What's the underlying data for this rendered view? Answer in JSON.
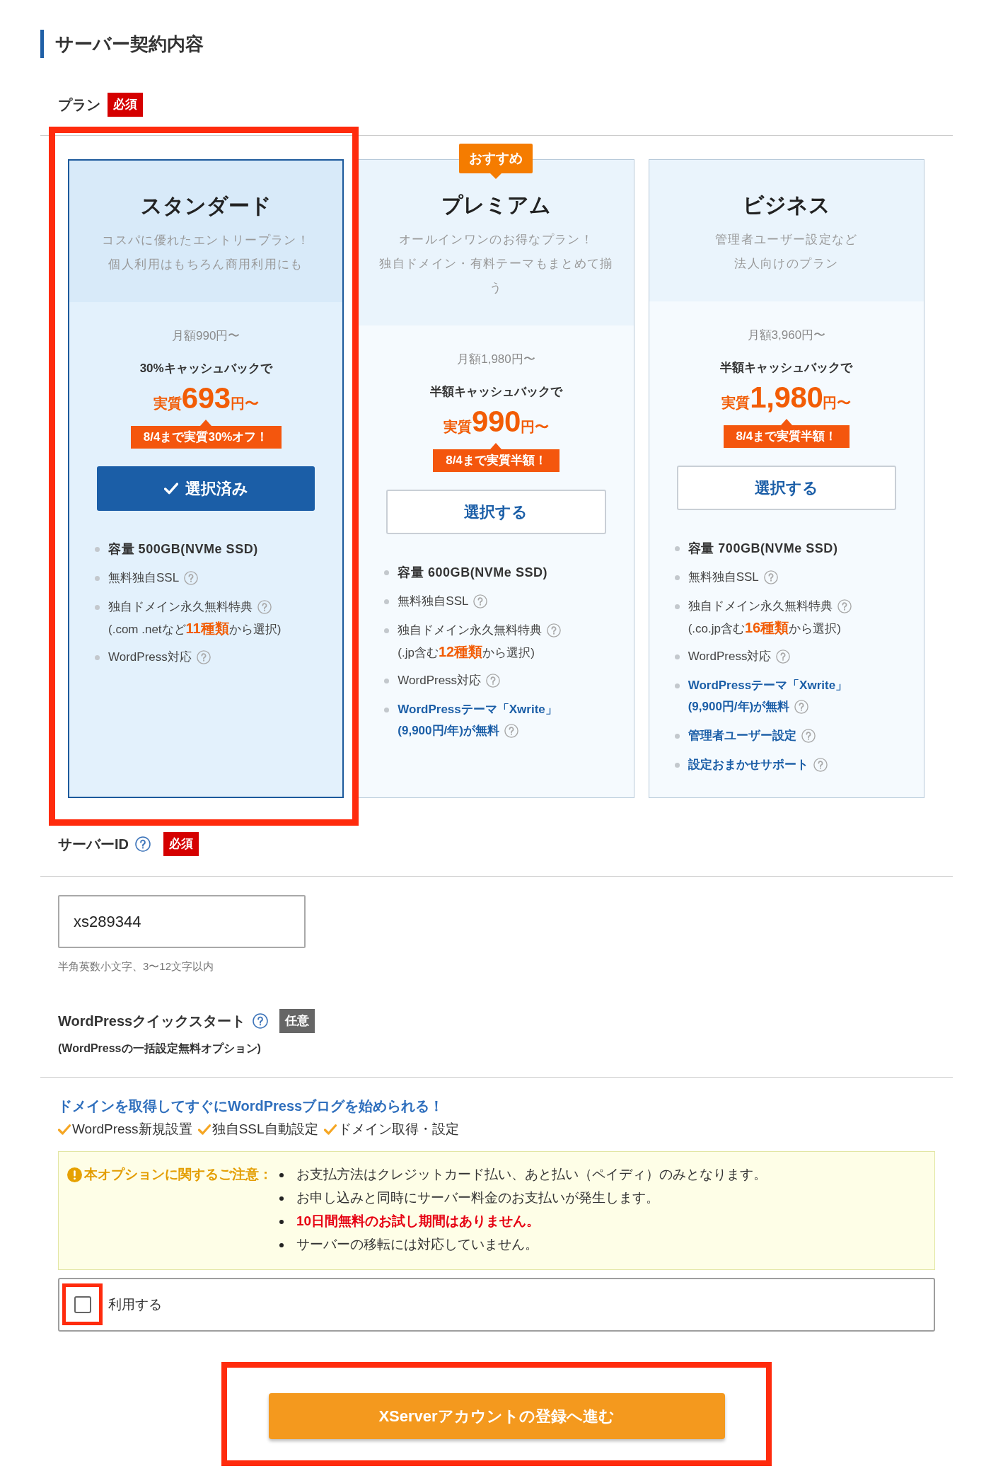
{
  "section": {
    "title": "サーバー契約内容"
  },
  "plan_field": {
    "label": "プラン",
    "badge": {
      "text": "必須",
      "kind": "required"
    }
  },
  "plans": [
    {
      "name": "スタンダード",
      "description": [
        "コスパに優れたエントリープラン！",
        "個人利用はもちろん商用利用にも"
      ],
      "monthly": "月額990円〜",
      "cashback": "30%キャッシュバックで",
      "price": {
        "prefix": "実質",
        "amount": "693",
        "suffix": "円〜"
      },
      "tag": "8/4まで実質30%オフ！",
      "button_label": "選択済み",
      "selected": true,
      "highlighted": true,
      "features": [
        {
          "kind": "capacity",
          "lines": [
            {
              "text": "容量 500GB(NVMe SSD)",
              "help": false
            }
          ]
        },
        {
          "kind": "plain",
          "lines": [
            {
              "text": "無料独自SSL",
              "help": true
            }
          ]
        },
        {
          "kind": "plain",
          "lines": [
            {
              "text": "独自ドメイン永久無料特典",
              "help": true
            },
            {
              "text": "(.com .netなど**11種類**から選択)",
              "help": false
            }
          ]
        },
        {
          "kind": "plain",
          "lines": [
            {
              "text": "WordPress対応",
              "help": true
            }
          ]
        }
      ]
    },
    {
      "name": "プレミアム",
      "badge": "おすすめ",
      "description": [
        "オールインワンのお得なプラン！",
        "独自ドメイン・有料テーマもまとめて揃う"
      ],
      "monthly": "月額1,980円〜",
      "cashback": "半額キャッシュバックで",
      "price": {
        "prefix": "実質",
        "amount": "990",
        "suffix": "円〜"
      },
      "tag": "8/4まで実質半額！",
      "button_label": "選択する",
      "selected": false,
      "highlighted": false,
      "features": [
        {
          "kind": "capacity",
          "lines": [
            {
              "text": "容量 600GB(NVMe SSD)",
              "help": false
            }
          ]
        },
        {
          "kind": "plain",
          "lines": [
            {
              "text": "無料独自SSL",
              "help": true
            }
          ]
        },
        {
          "kind": "plain",
          "lines": [
            {
              "text": "独自ドメイン永久無料特典",
              "help": true
            },
            {
              "text": "(.jp含む**12種類**から選択)",
              "help": false
            }
          ]
        },
        {
          "kind": "plain",
          "lines": [
            {
              "text": "WordPress対応",
              "help": true
            }
          ]
        },
        {
          "kind": "highlight",
          "lines": [
            {
              "text": "WordPressテーマ「Xwrite」",
              "help": false
            },
            {
              "text": "(9,900円/年)が無料",
              "help": true
            }
          ]
        }
      ]
    },
    {
      "name": "ビジネス",
      "description": [
        "管理者ユーザー設定など",
        "法人向けのプラン"
      ],
      "monthly": "月額3,960円〜",
      "cashback": "半額キャッシュバックで",
      "price": {
        "prefix": "実質",
        "amount": "1,980",
        "suffix": "円〜"
      },
      "tag": "8/4まで実質半額！",
      "button_label": "選択する",
      "selected": false,
      "highlighted": false,
      "features": [
        {
          "kind": "capacity",
          "lines": [
            {
              "text": "容量 700GB(NVMe SSD)",
              "help": false
            }
          ]
        },
        {
          "kind": "plain",
          "lines": [
            {
              "text": "無料独自SSL",
              "help": true
            }
          ]
        },
        {
          "kind": "plain",
          "lines": [
            {
              "text": "独自ドメイン永久無料特典",
              "help": true
            },
            {
              "text": "(.co.jp含む**16種類**から選択)",
              "help": false
            }
          ]
        },
        {
          "kind": "plain",
          "lines": [
            {
              "text": "WordPress対応",
              "help": true
            }
          ]
        },
        {
          "kind": "highlight",
          "lines": [
            {
              "text": "WordPressテーマ「Xwrite」",
              "help": false
            },
            {
              "text": "(9,900円/年)が無料",
              "help": true
            }
          ]
        },
        {
          "kind": "highlight",
          "lines": [
            {
              "text": "管理者ユーザー設定",
              "help": true
            }
          ]
        },
        {
          "kind": "highlight",
          "lines": [
            {
              "text": "設定おまかせサポート",
              "help": true
            }
          ]
        }
      ]
    }
  ],
  "server_id": {
    "label": "サーバーID",
    "help": true,
    "badge": {
      "text": "必須",
      "kind": "required"
    },
    "value": "xs289344",
    "hint": "半角英数小文字、3〜12文字以内"
  },
  "quick_start": {
    "label": "WordPressクイックスタート",
    "help": true,
    "badge": {
      "text": "任意",
      "kind": "optional"
    },
    "sublabel": "(WordPressの一括設定無料オプション)",
    "headline": "ドメインを取得してすぐにWordPressブログを始められる！",
    "features": [
      "WordPress新規設置",
      "独自SSL自動設定",
      "ドメイン取得・設定"
    ],
    "notice": {
      "title": "本オプションに関するご注意：",
      "items": [
        {
          "text": "お支払方法はクレジットカード払い、あと払い（ペイディ）のみとなります。",
          "emphasis": false
        },
        {
          "text": "お申し込みと同時にサーバー料金のお支払いが発生します。",
          "emphasis": false
        },
        {
          "text": "10日間無料のお試し期間はありません。",
          "emphasis": true
        },
        {
          "text": "サーバーの移転には対応していません。",
          "emphasis": false
        }
      ]
    },
    "checkbox": {
      "label": "利用する",
      "checked": false,
      "highlighted": true
    }
  },
  "submit": {
    "label": "XServerアカウントの登録へ進む",
    "highlighted": true
  }
}
